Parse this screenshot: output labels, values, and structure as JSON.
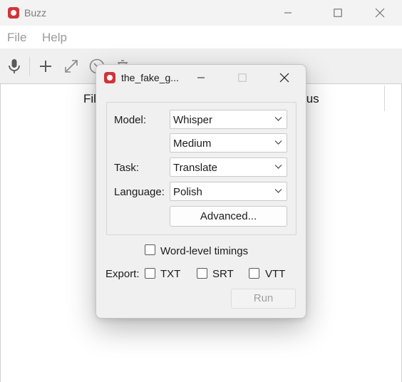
{
  "main_window": {
    "title": "Buzz",
    "menu": [
      {
        "label": "File"
      },
      {
        "label": "Help"
      }
    ],
    "table": {
      "columns": [
        {
          "label": "Fil"
        },
        {
          "label": "tus"
        }
      ]
    }
  },
  "dialog": {
    "title": "the_fake_g...",
    "model_label": "Model:",
    "model_value": "Whisper",
    "model_size_value": "Medium",
    "task_label": "Task:",
    "task_value": "Translate",
    "language_label": "Language:",
    "language_value": "Polish",
    "advanced_label": "Advanced...",
    "word_level_label": "Word-level timings",
    "export_label": "Export:",
    "export_options": [
      {
        "label": "TXT",
        "checked": false
      },
      {
        "label": "SRT",
        "checked": false
      },
      {
        "label": "VTT",
        "checked": false
      }
    ],
    "run_label": "Run"
  },
  "colors": {
    "app_icon": "#d13438",
    "titlebar_bg": "#f3f3f3",
    "toolbar_bg": "#f0f0f0",
    "dialog_bg": "#f0f0f0",
    "disabled_text": "#a0a0a0"
  },
  "icons": {
    "toolbar": [
      "microphone-icon",
      "plus-icon",
      "expand-icon",
      "cancel-icon",
      "trash-icon"
    ]
  }
}
